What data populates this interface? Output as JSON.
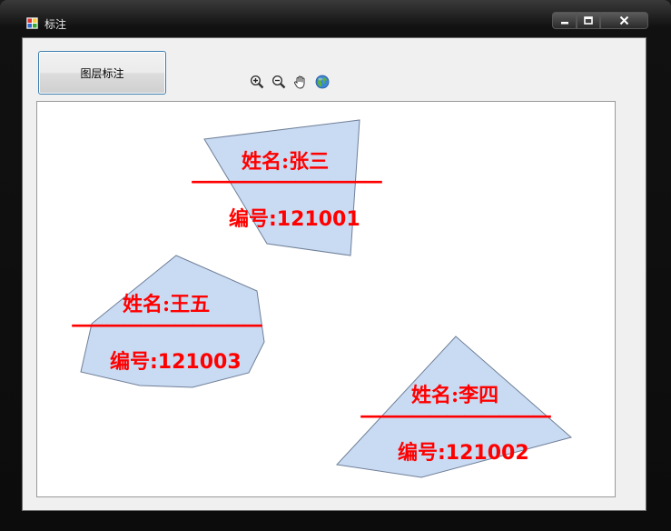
{
  "window": {
    "title": "标注"
  },
  "toolbar": {
    "layer_label_button": "图层标注"
  },
  "icons": [
    "zoom-in-icon",
    "zoom-out-icon",
    "pan-hand-icon",
    "globe-icon"
  ],
  "colors": {
    "polygon_fill": "#c9dbf2",
    "polygon_stroke": "#6f7f98",
    "label": "#ff0000"
  },
  "features": [
    {
      "name": "姓名:张三",
      "divider": "———————————",
      "number": "编号:121001"
    },
    {
      "name": "姓名:王五",
      "divider": "———————————",
      "number": "编号:121003"
    },
    {
      "name": "姓名:李四",
      "divider": "———————————",
      "number": "编号:121002"
    }
  ]
}
